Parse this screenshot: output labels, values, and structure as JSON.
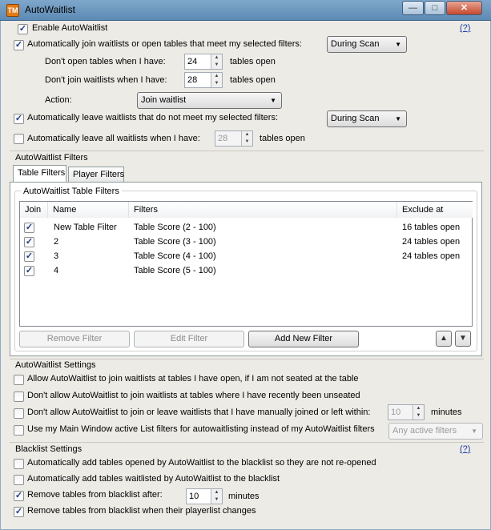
{
  "window": {
    "title": "AutoWaitlist",
    "icon_letters": "TM",
    "minimize_glyph": "—",
    "maximize_glyph": "□",
    "close_glyph": "✕"
  },
  "checkmark": "✓",
  "arrow_down": "▼",
  "arrow_up": "▲",
  "help_link": "(?)",
  "general": {
    "enable_autowaitlist": {
      "label": "Enable AutoWaitlist",
      "checked": true
    },
    "auto_join": {
      "label": "Automatically join waitlists or open tables that meet my selected filters:",
      "checked": true,
      "dropdown": "During Scan"
    },
    "dont_open": {
      "label": "Don't open tables when I have:",
      "value": "24",
      "suffix": "tables open"
    },
    "dont_join": {
      "label": "Don't join waitlists when I have:",
      "value": "28",
      "suffix": "tables open"
    },
    "action": {
      "label": "Action:",
      "dropdown": "Join waitlist"
    },
    "auto_leave": {
      "label": "Automatically leave waitlists that do not meet my selected filters:",
      "checked": true,
      "dropdown": "During Scan"
    },
    "auto_leave_all": {
      "label": "Automatically leave all waitlists when I have:",
      "checked": false,
      "value": "28",
      "suffix": "tables open"
    }
  },
  "filters_section": {
    "title": "AutoWaitlist Filters",
    "tabs": [
      "Table Filters",
      "Player Filters"
    ],
    "group_title": "AutoWaitlist Table Filters",
    "columns": [
      "Join",
      "Name",
      "Filters",
      "Exclude at"
    ],
    "rows": [
      {
        "join": true,
        "name": "New Table Filter",
        "filters": "Table Score (2 - 100)",
        "exclude": "16 tables open"
      },
      {
        "join": true,
        "name": "2",
        "filters": "Table Score (3 - 100)",
        "exclude": "24 tables open"
      },
      {
        "join": true,
        "name": "3",
        "filters": "Table Score (4 - 100)",
        "exclude": "24 tables open"
      },
      {
        "join": true,
        "name": "4",
        "filters": "Table Score (5 - 100)",
        "exclude": ""
      }
    ],
    "buttons": {
      "remove": "Remove Filter",
      "edit": "Edit Filter",
      "add": "Add New Filter"
    }
  },
  "settings_section": {
    "title": "AutoWaitlist Settings",
    "allow_join_open": {
      "label": "Allow AutoWaitlist to join waitlists at tables I have open, if I am not seated at the table",
      "checked": false
    },
    "dont_allow_unseated": {
      "label": "Don't allow AutoWaitlist to join waitlists at tables where I have recently been unseated",
      "checked": false
    },
    "dont_allow_manual": {
      "label": "Don't allow AutoWaitlist to join or leave waitlists that I have manually joined or left within:",
      "checked": false,
      "value": "10",
      "suffix": "minutes"
    },
    "use_main_window": {
      "label": "Use my Main Window active List filters for autowaitlisting instead of my AutoWaitlist filters",
      "checked": false,
      "dropdown": "Any active filters"
    }
  },
  "blacklist_section": {
    "title": "Blacklist Settings",
    "add_opened": {
      "label": "Automatically add tables opened by AutoWaitlist to the blacklist so they are not re-opened",
      "checked": false
    },
    "add_waitlisted": {
      "label": "Automatically add tables waitlisted by AutoWaitlist to the blacklist",
      "checked": false
    },
    "remove_after": {
      "label": "Remove tables from blacklist after:",
      "checked": true,
      "value": "10",
      "suffix": "minutes"
    },
    "remove_changes": {
      "label": "Remove tables from blacklist when their playerlist changes",
      "checked": true
    }
  }
}
